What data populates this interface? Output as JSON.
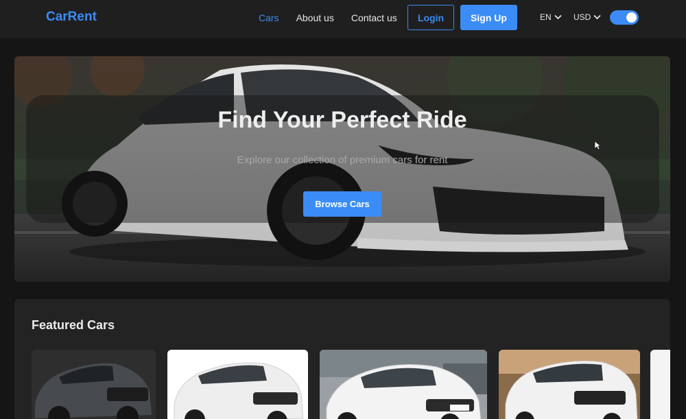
{
  "brand": "CarRent",
  "nav": {
    "links": [
      {
        "label": "Cars",
        "active": true
      },
      {
        "label": "About us",
        "active": false
      },
      {
        "label": "Contact us",
        "active": false
      }
    ],
    "login_label": "Login",
    "signup_label": "Sign Up",
    "language": "EN",
    "currency": "USD",
    "theme_toggle_on": true
  },
  "hero": {
    "title": "Find Your Perfect Ride",
    "subtitle": "Explore our collection of premium cars for rent",
    "cta_label": "Browse Cars"
  },
  "featured": {
    "title": "Featured Cars",
    "cards": [
      {
        "image": "dark-gray-suv"
      },
      {
        "image": "white-rav4"
      },
      {
        "image": "white-hatchback"
      },
      {
        "image": "white-rav4-front"
      }
    ]
  },
  "colors": {
    "accent": "#3b8cf6",
    "background": "#151515",
    "navbar": "#1f1f1f",
    "panel": "#232323"
  }
}
